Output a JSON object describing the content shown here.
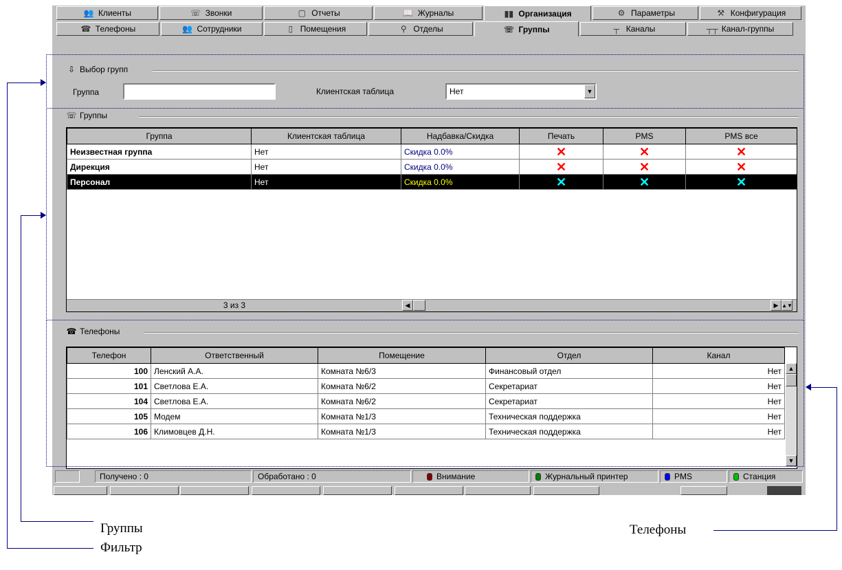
{
  "main_tabs": [
    {
      "label": "Клиенты",
      "icon": "clients-icon",
      "glyph": "👥"
    },
    {
      "label": "Звонки",
      "icon": "calls-icon",
      "glyph": "☏"
    },
    {
      "label": "Отчеты",
      "icon": "reports-icon",
      "glyph": "▢"
    },
    {
      "label": "Журналы",
      "icon": "journals-icon",
      "glyph": "📖"
    },
    {
      "label": "Организация",
      "icon": "organization-icon",
      "glyph": "▮▮",
      "active": true
    },
    {
      "label": "Параметры",
      "icon": "parameters-icon",
      "glyph": "⚙"
    },
    {
      "label": "Конфигурация",
      "icon": "configuration-icon",
      "glyph": "⚒"
    }
  ],
  "sub_tabs": [
    {
      "label": "Телефоны",
      "icon": "phones-icon",
      "glyph": "☎"
    },
    {
      "label": "Сотрудники",
      "icon": "employees-icon",
      "glyph": "👥"
    },
    {
      "label": "Помещения",
      "icon": "rooms-icon",
      "glyph": "▯"
    },
    {
      "label": "Отделы",
      "icon": "departments-icon",
      "glyph": "⚲"
    },
    {
      "label": "Группы",
      "icon": "groups-icon",
      "glyph": "☏",
      "active": true
    },
    {
      "label": "Каналы",
      "icon": "channels-icon",
      "glyph": "┬"
    },
    {
      "label": "Канал-группы",
      "icon": "channel-groups-icon",
      "glyph": "┬┬"
    }
  ],
  "filter": {
    "title": "Выбор групп",
    "group_label": "Группа",
    "group_value": "",
    "client_table_label": "Клиентская таблица",
    "client_table_value": "Нет"
  },
  "groups": {
    "title": "Группы",
    "columns": [
      "Группа",
      "Клиентская таблица",
      "Надбавка/Скидка",
      "Печать",
      "PMS",
      "PMS все"
    ],
    "rows": [
      {
        "name": "Неизвестная группа",
        "client_table": "Нет",
        "discount": "Скидка 0.0%",
        "print": "✕",
        "pms": "✕",
        "pms_all": "✕",
        "selected": false
      },
      {
        "name": "Дирекция",
        "client_table": "Нет",
        "discount": "Скидка 0.0%",
        "print": "✕",
        "pms": "✕",
        "pms_all": "✕",
        "selected": false
      },
      {
        "name": "Персонал",
        "client_table": "Нет",
        "discount": "Скидка 0.0%",
        "print": "✕",
        "pms": "✕",
        "pms_all": "✕",
        "selected": true
      }
    ],
    "counter": "3 из 3"
  },
  "phones": {
    "title": "Телефоны",
    "columns": [
      "Телефон",
      "Ответственный",
      "Помещение",
      "Отдел",
      "Канал"
    ],
    "rows": [
      {
        "phone": "100",
        "responsible": "Ленский А.А.",
        "room": "Комната №6/3",
        "department": "Финансовый отдел",
        "channel": "Нет"
      },
      {
        "phone": "101",
        "responsible": "Светлова Е.А.",
        "room": "Комната №6/2",
        "department": "Секретариат",
        "channel": "Нет"
      },
      {
        "phone": "104",
        "responsible": "Светлова Е.А.",
        "room": "Комната №6/2",
        "department": "Секретариат",
        "channel": "Нет"
      },
      {
        "phone": "105",
        "responsible": "Модем",
        "room": "Комната №1/3",
        "department": "Техническая поддержка",
        "channel": "Нет"
      },
      {
        "phone": "106",
        "responsible": "Климовцев Д.Н.",
        "room": "Комната №1/3",
        "department": "Техническая поддержка",
        "channel": "Нет"
      }
    ]
  },
  "status": {
    "received": "Получено : 0",
    "processed": "Обработано : 0",
    "attention": "Внимание",
    "journal_printer": "Журнальный принтер",
    "pms": "PMS",
    "station": "Станция",
    "colors": {
      "attention": "#800000",
      "journal_printer": "#008000",
      "pms": "#0000ff",
      "station": "#00c000"
    }
  },
  "annotations": {
    "groups": "Группы",
    "filter": "Фильтр",
    "phones": "Телефоны"
  }
}
